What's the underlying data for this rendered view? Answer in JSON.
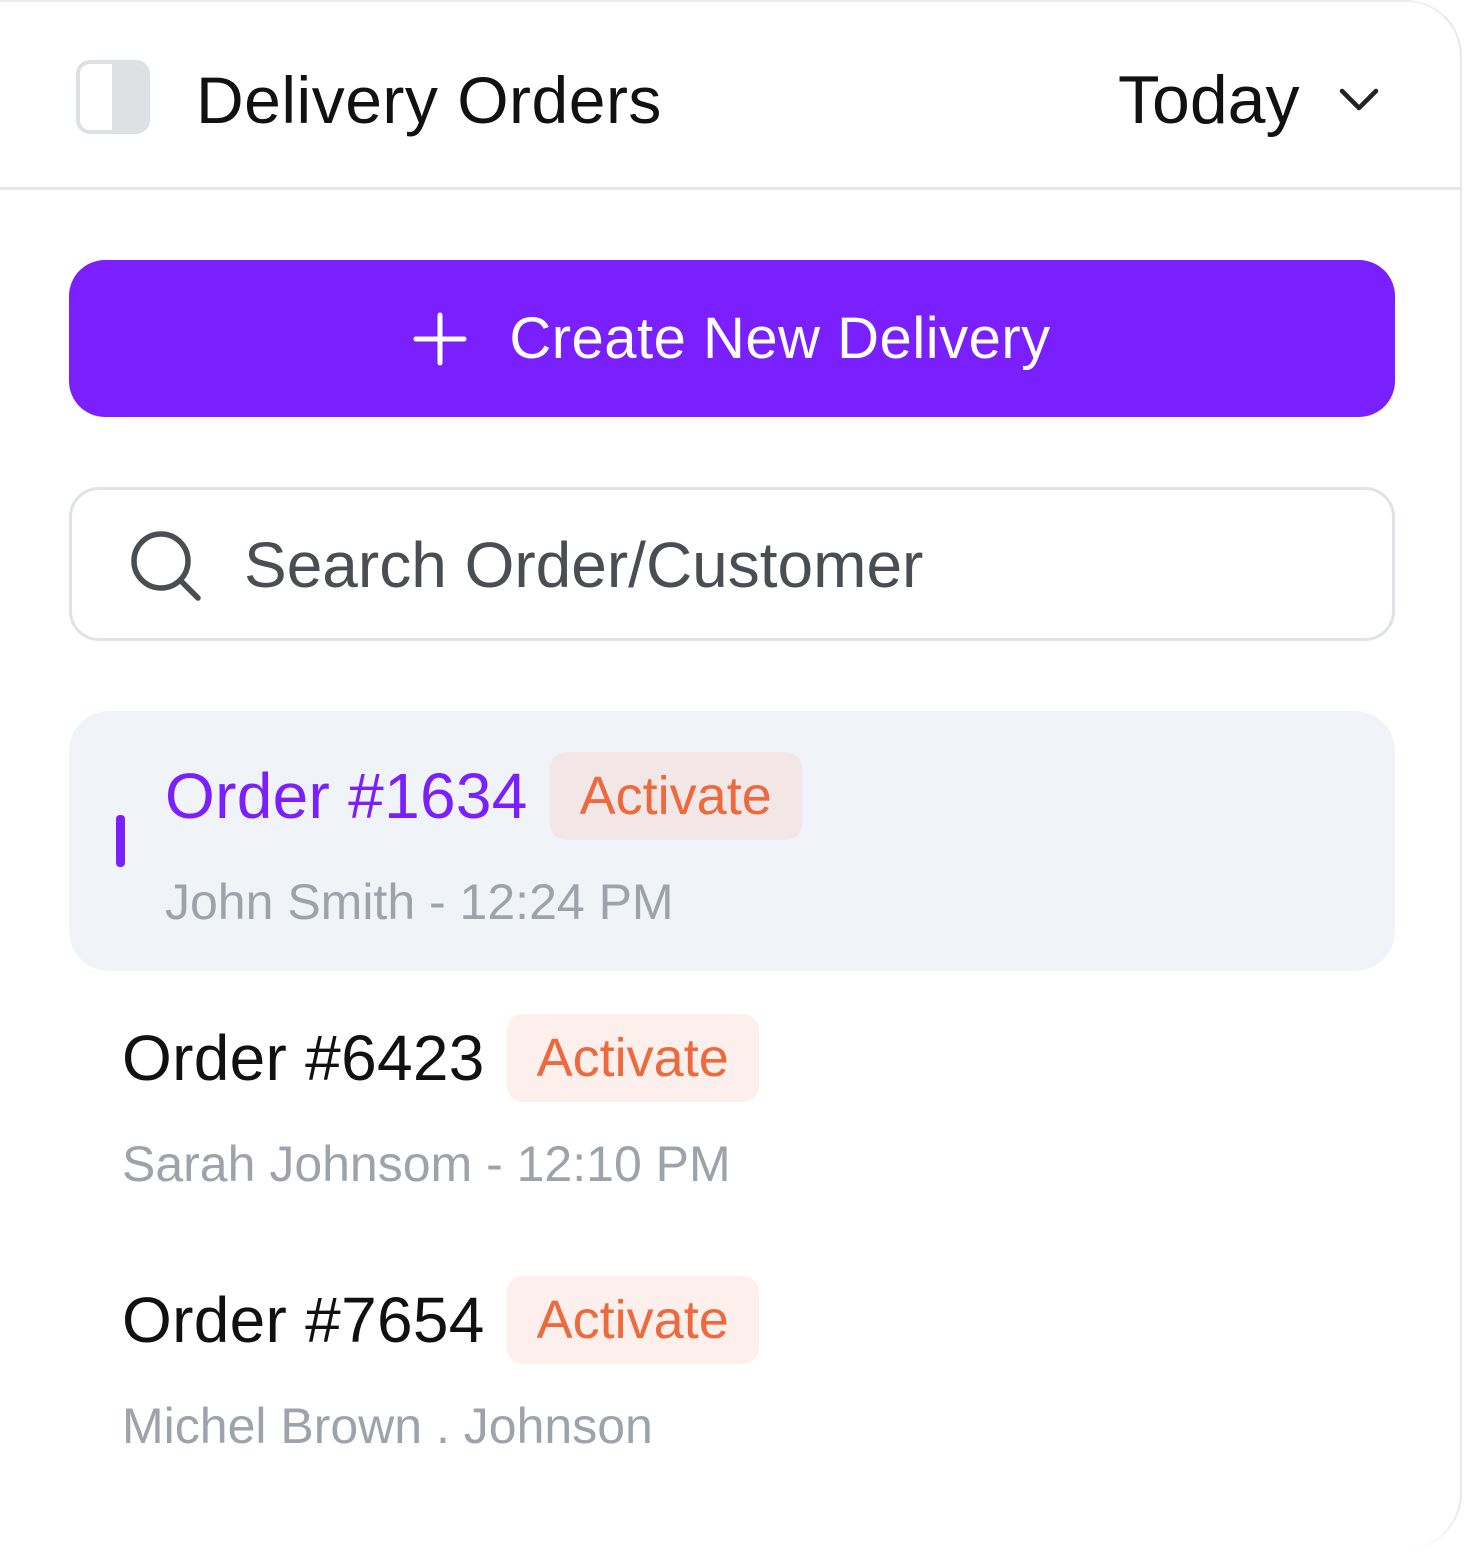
{
  "header": {
    "title": "Delivery Orders",
    "date_filter": "Today"
  },
  "actions": {
    "create_label": "Create New Delivery"
  },
  "search": {
    "placeholder": "Search Order/Customer"
  },
  "orders": [
    {
      "title": "Order #1634",
      "status": "Activate",
      "meta": "John Smith - 12:24 PM",
      "selected": true
    },
    {
      "title": "Order #6423",
      "status": "Activate",
      "meta": "Sarah Johnsom - 12:10 PM",
      "selected": false
    },
    {
      "title": "Order #7654",
      "status": "Activate",
      "meta": "Michel Brown . Johnson",
      "selected": false
    }
  ],
  "colors": {
    "accent": "#7a1ffd",
    "status_text": "#ec6a3e",
    "status_bg": "#fdefeb",
    "selected_bg": "#f0f3f8",
    "muted_text": "#9ea3ab"
  },
  "icons": {
    "sidebar": "sidebar-toggle-icon",
    "dropdown": "chevron-down-icon",
    "create": "plus-icon",
    "search": "search-icon"
  }
}
